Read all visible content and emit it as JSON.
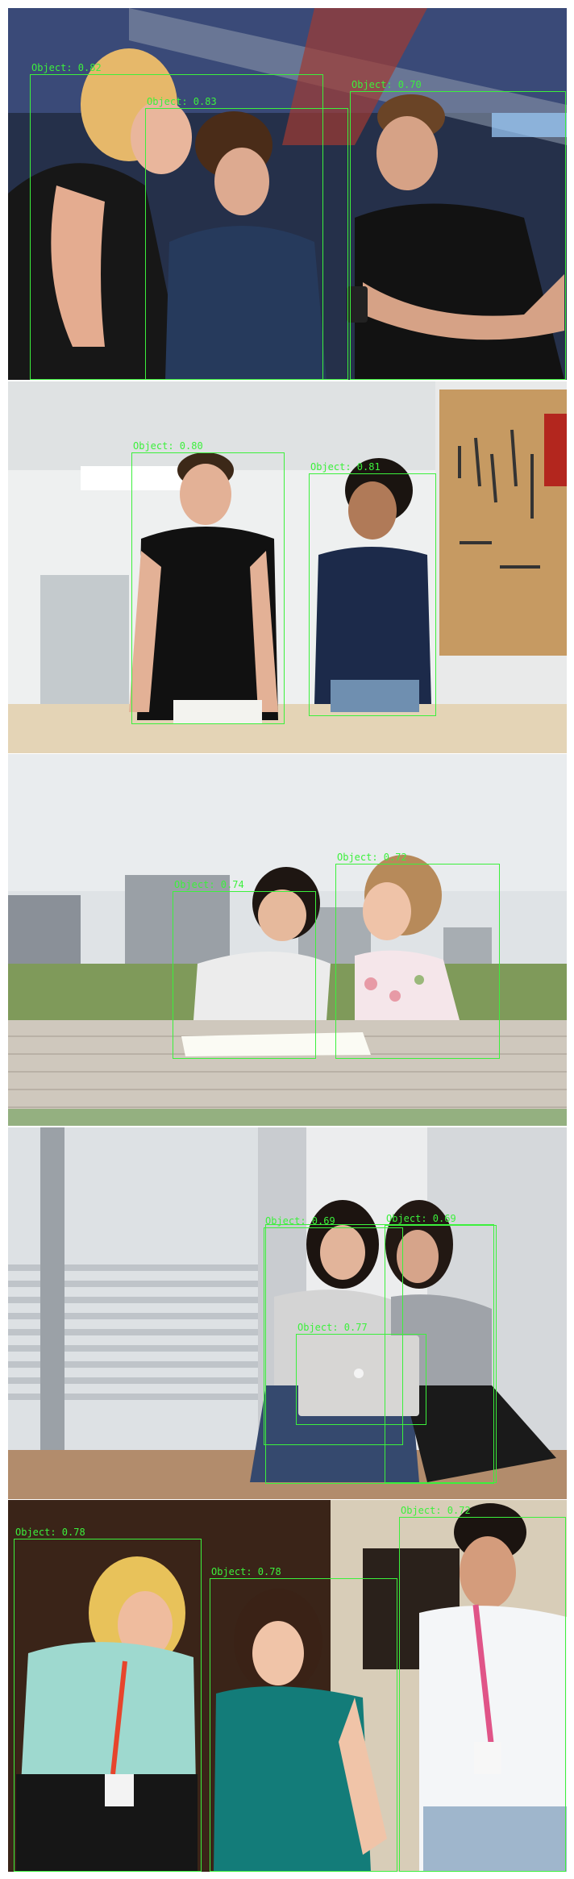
{
  "panels": [
    {
      "scene": "three people looking at a phone under ceiling ducts",
      "detections": [
        {
          "label": "Object: 0.82"
        },
        {
          "label": "Object: 0.83"
        },
        {
          "label": "Object: 0.70"
        }
      ]
    },
    {
      "scene": "man and woman at a workbench with a tool wall",
      "detections": [
        {
          "label": "Object: 0.80"
        },
        {
          "label": "Object: 0.81"
        }
      ]
    },
    {
      "scene": "two women studying at an outdoor table",
      "detections": [
        {
          "label": "Object: 0.74"
        },
        {
          "label": "Object: 0.72"
        }
      ]
    },
    {
      "scene": "two women sitting on the floor with a laptop by a window",
      "detections": [
        {
          "label": "Object: 0.69"
        },
        {
          "label": "Object: 0.69"
        },
        {
          "label": "Object: 0.77"
        }
      ]
    },
    {
      "scene": "three coworkers with lanyards looking down at a table",
      "detections": [
        {
          "label": "Object: 0.78"
        },
        {
          "label": "Object: 0.78"
        },
        {
          "label": "Object: 0.72"
        }
      ]
    }
  ],
  "colors": {
    "box": "#3cf03c"
  }
}
